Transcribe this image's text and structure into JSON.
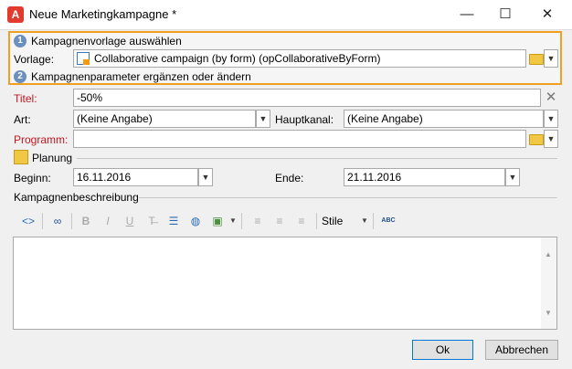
{
  "window": {
    "title": "Neue Marketingkampagne *",
    "app_icon_glyph": "A",
    "minimize_glyph": "—",
    "maximize_glyph": "☐",
    "close_glyph": "✕"
  },
  "template_section": {
    "step1_number": "1",
    "step1_label": "Kampagnenvorlage auswählen",
    "vorlage_label": "Vorlage:",
    "vorlage_value": "Collaborative campaign (by form) (opCollaborativeByForm)",
    "step2_number": "2",
    "step2_label": "Kampagnenparameter ergänzen oder ändern"
  },
  "fields": {
    "titel_label": "Titel:",
    "titel_value": "-50%",
    "art_label": "Art:",
    "art_value": "(Keine Angabe)",
    "hauptkanal_label": "Hauptkanal:",
    "hauptkanal_value": "(Keine Angabe)",
    "programm_label": "Programm:",
    "programm_value": ""
  },
  "planung": {
    "section_label": "Planung",
    "beginn_label": "Beginn:",
    "beginn_value": "16.11.2016",
    "ende_label": "Ende:",
    "ende_value": "21.11.2016"
  },
  "description": {
    "section_label": "Kampagnenbeschreibung",
    "toolbar": {
      "bold": "B",
      "italic": "I",
      "underline": "U",
      "style_label": "Stile",
      "spellcheck": "ABC"
    },
    "content": ""
  },
  "buttons": {
    "ok_label": "Ok",
    "cancel_label": "Abbrechen"
  },
  "colors": {
    "highlight_border": "#f0a020",
    "required_label": "#c0161f",
    "step_badge": "#6a8fc0",
    "app_icon": "#e23b2e"
  }
}
